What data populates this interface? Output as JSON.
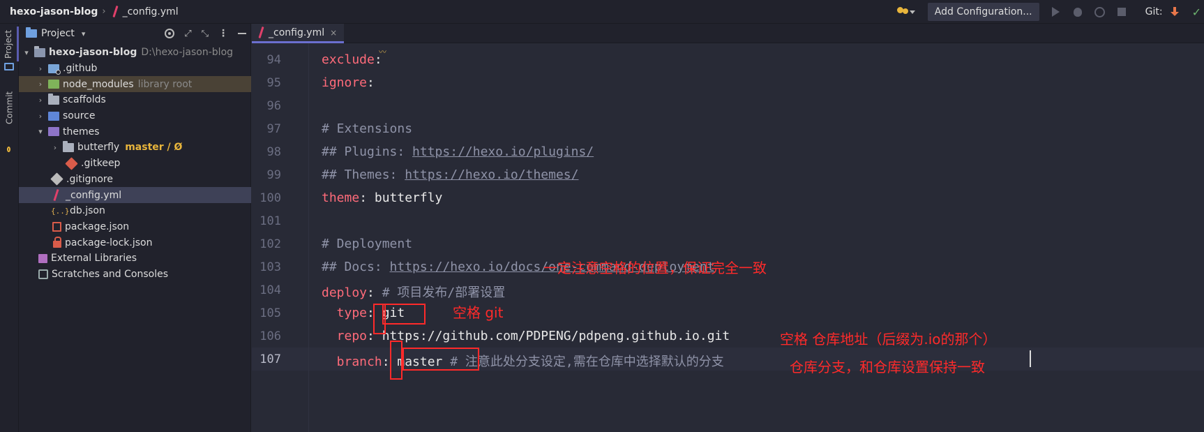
{
  "titlebar": {
    "project": "hexo-jason-blog",
    "file": "_config.yml",
    "add_configuration": "Add Configuration...",
    "git_label": "Git:"
  },
  "strip": {
    "project_tab": "Project",
    "commit_tab": "Commit"
  },
  "panel": {
    "title": "Project",
    "root": {
      "name": "hexo-jason-blog",
      "path": "D:\\hexo-jason-blog"
    },
    "items": [
      {
        "name": ".github"
      },
      {
        "name": "node_modules",
        "hint": "library root"
      },
      {
        "name": "scaffolds"
      },
      {
        "name": "source"
      },
      {
        "name": "themes"
      },
      {
        "name": "butterfly",
        "branch": "master / Ø"
      },
      {
        "name": ".gitkeep"
      },
      {
        "name": ".gitignore"
      },
      {
        "name": "_config.yml"
      },
      {
        "name": "db.json"
      },
      {
        "name": "package.json"
      },
      {
        "name": "package-lock.json"
      },
      {
        "name": "External Libraries"
      },
      {
        "name": "Scratches and Consoles"
      }
    ]
  },
  "editor": {
    "tab": "_config.yml",
    "lines": [
      {
        "n": "94",
        "key": "exclude",
        "rest": ":"
      },
      {
        "n": "95",
        "key": "ignore",
        "rest": ":"
      },
      {
        "n": "96"
      },
      {
        "n": "97",
        "comment": "# Extensions"
      },
      {
        "n": "98",
        "comment": "## Plugins: ",
        "url": "https://hexo.io/plugins/"
      },
      {
        "n": "99",
        "comment": "## Themes: ",
        "url": "https://hexo.io/themes/"
      },
      {
        "n": "100",
        "key": "theme",
        "rest": ": butterfly"
      },
      {
        "n": "101"
      },
      {
        "n": "102",
        "comment": "# Deployment"
      },
      {
        "n": "103",
        "comment": "## Docs: ",
        "url": "https://hexo.io/docs/one-command-deployment"
      },
      {
        "n": "104",
        "key": "deploy",
        "rest": ": ",
        "trailing": "# 项目发布/部署设置"
      },
      {
        "n": "105",
        "key": "  type",
        "rest": ": git"
      },
      {
        "n": "106",
        "key": "  repo",
        "rest": ": https://github.com/PDPENG/pdpeng.github.io.git"
      },
      {
        "n": "107",
        "key": "  branch",
        "rest": ": master ",
        "trailing": "# 注意此处分支设定,需在仓库中选择默认的分支"
      }
    ]
  },
  "annotations": {
    "a1": "一定注意空格的位置，保证完全一致",
    "a2": "空格 git",
    "a3": "空格 仓库地址（后缀为.io的那个）",
    "a4": "仓库分支，和仓库设置保持一致"
  },
  "colors": {
    "annotation": "#ff2a2a",
    "key": "#ff6b7a",
    "comment": "#8f93a8",
    "branch": "#e8b53c"
  }
}
